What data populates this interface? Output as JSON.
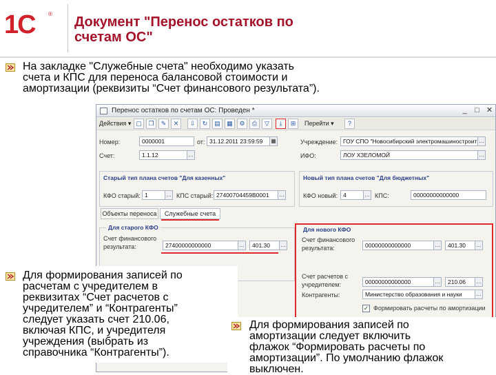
{
  "slide": {
    "logo": "1С",
    "title_line1": "Документ \"Перенос остатков по",
    "title_line2": "счетам ОС\"",
    "bullet1": {
      "line1": "На закладке \"Служебные счета\" необходимо указать",
      "line2": "счета и КПС для переноса балансовой стоимости и",
      "line3": "амортизации (реквизиты “Счет финансового результата”)."
    },
    "bullet2": {
      "line1": "Для формирования записей по",
      "line2": "расчетам с учредителем в",
      "line3": "реквизитах “Счет расчетов с",
      "line4": "учредителем” и “Контрагенты”",
      "line5": "следует указать счет 210.06,",
      "line6": "включая КПС, и учредителя",
      "line7": "учреждения (выбрать из",
      "line8": "справочника “Контрагенты”)."
    },
    "bullet3": {
      "line1": "Для формирования записей по",
      "line2": "амортизации следует включить",
      "line3": "флажок “Формировать расчеты по",
      "line4": "амортизации”. По умолчанию флажок",
      "line5": "выключен."
    },
    "colors": {
      "title": "#a5132a",
      "logo": "#d0202a",
      "highlight_border": "#e0272b"
    }
  },
  "window": {
    "title": "Перенос остатков по счетам ОС: Проведен *",
    "controls": [
      "_",
      "□",
      "✕"
    ],
    "toolbar": {
      "actions": "Действия ▾",
      "goto": "Перейти ▾"
    },
    "fields": {
      "nomer_label": "Номер:",
      "nomer_value": "0000001",
      "date_label": "от:",
      "date_value": "31.12.2011 23:59:59",
      "uchr_label": "Учреждение:",
      "uchr_value": "ГОУ СПО \"Новосибирский электромашиностроит",
      "schet_label": "Счет:",
      "schet_value": "1.1.12",
      "ifo_label": "ИФО:",
      "ifo_value": "ЛОУ ХЗЕЛОМОЙ"
    },
    "old_plan": {
      "title": "Старый тип плана счетов \"Для казенных\"",
      "kfo_label": "КФО старый:",
      "kfo_value": "1",
      "kps_label": "КПС старый:",
      "kps_value": "27400704459B0001"
    },
    "new_plan": {
      "title": "Новый тип плана счетов \"Для бюджетных\"",
      "kfo_label": "КФО новый:",
      "kfo_value": "4",
      "kps_label": "КПС:",
      "kps_value": "00000000000000"
    },
    "tabs": [
      "Объекты переноса",
      "Служебные счета"
    ],
    "left_group": {
      "title": "Для старого КФО",
      "fin_label_1": "Счет финансового",
      "fin_label_2": "результата:",
      "kps_value": "27400000000000",
      "acct_value": "401.30"
    },
    "right_group": {
      "title": "Для нового КФО",
      "fin_label_1": "Счет финансового",
      "fin_label_2": "результата:",
      "kps_value": "00000000000000",
      "acct_value": "401.30",
      "uchr_label_1": "Счет расчетов с",
      "uchr_label_2": "учредителем:",
      "uchr_kps": "00000000000000",
      "uchr_acct": "210.06",
      "kontr_label": "Контрагенты:",
      "kontr_value": "Министерство образования и науки",
      "flag_label": "Формировать расчеты по амортизации"
    }
  }
}
